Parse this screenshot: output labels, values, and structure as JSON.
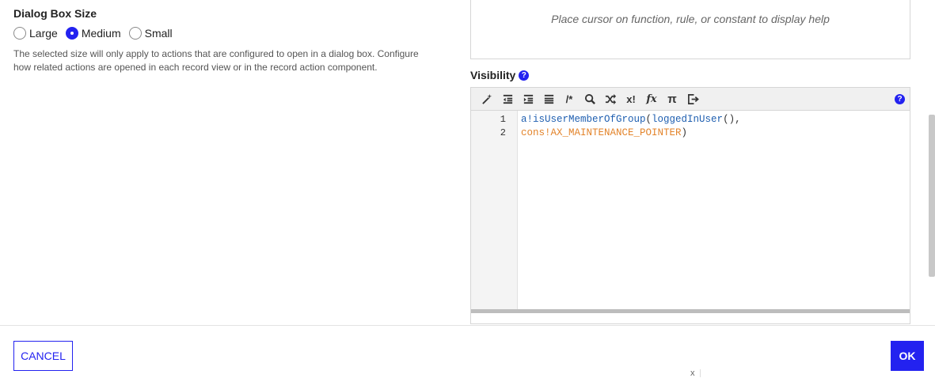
{
  "dialog_size": {
    "title": "Dialog Box Size",
    "options": [
      {
        "label": "Large",
        "selected": false
      },
      {
        "label": "Medium",
        "selected": true
      },
      {
        "label": "Small",
        "selected": false
      }
    ],
    "help_text": "The selected size will only apply to actions that are configured to open in a dialog box. Configure how related actions are opened in each record view or in the record action component."
  },
  "help_panel": {
    "message": "Place cursor on function, rule, or constant to display help"
  },
  "visibility": {
    "label": "Visibility",
    "help_icon": "question-circle-icon"
  },
  "editor": {
    "toolbar_icons": [
      "magic-wand-icon",
      "outdent-icon",
      "indent-icon",
      "list-icon",
      "comment-icon",
      "search-icon",
      "shuffle-icon",
      "x-exclamation-icon",
      "function-icon",
      "pi-icon",
      "export-icon"
    ],
    "toolbar_text": {
      "comment": "/*",
      "x_excl": "x!",
      "fx": "fx",
      "pi": "π"
    },
    "line_numbers": [
      "1",
      "2"
    ],
    "lines": [
      {
        "fn": "a!isUserMemberOfGroup",
        "punct": "(",
        "arg": "loggedInUser",
        "tail": "(),"
      },
      {
        "const": "cons!AX_MAINTENANCE_POINTER",
        "tail": ")"
      }
    ]
  },
  "footer": {
    "cancel_label": "CANCEL",
    "ok_label": "OK",
    "tiny_label": "x"
  },
  "colors": {
    "accent": "#2322f0",
    "function": "#1f5fb0",
    "constant": "#e3842b"
  }
}
